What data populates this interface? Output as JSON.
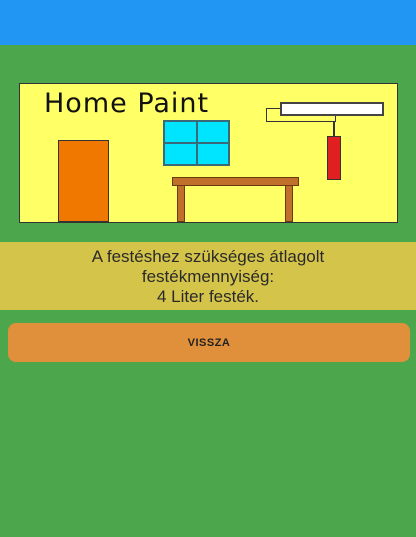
{
  "banner": {
    "title": "Home Paint"
  },
  "result": {
    "line1": "A festéshez szükséges átlagolt",
    "line2": "festékmennyiség:",
    "line3": "4 Liter festék."
  },
  "back_button": {
    "label": "VISSZA"
  },
  "colors": {
    "status_bar": "#2196F3",
    "background": "#4CA64C",
    "banner": "#FFFF66",
    "result_box": "#D4C44A",
    "button": "#E0903A"
  }
}
